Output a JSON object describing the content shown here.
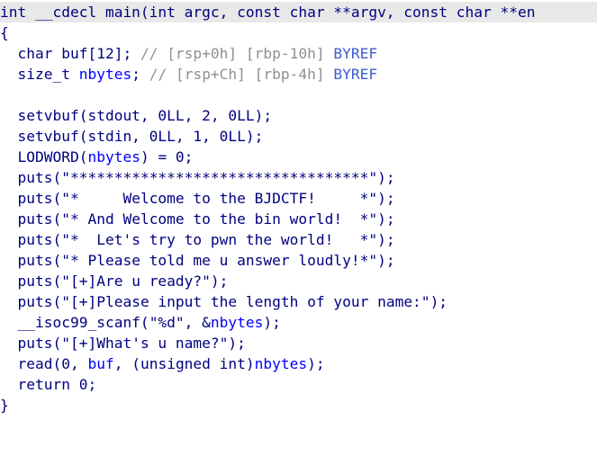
{
  "lines": [
    "int __cdecl main(int argc, const char **argv, const char **en",
    "{",
    "  char buf[12]; // [rsp+0h] [rbp-10h] BYREF",
    "  size_t nbytes; // [rsp+Ch] [rbp-4h] BYREF",
    "",
    "  setvbuf(stdout, 0LL, 2, 0LL);",
    "  setvbuf(stdin, 0LL, 1, 0LL);",
    "  LODWORD(nbytes) = 0;",
    "  puts(\"**********************************\");",
    "  puts(\"*     Welcome to the BJDCTF!     *\");",
    "  puts(\"* And Welcome to the bin world!  *\");",
    "  puts(\"*  Let's try to pwn the world!   *\");",
    "  puts(\"* Please told me u answer loudly!*\");",
    "  puts(\"[+]Are u ready?\");",
    "  puts(\"[+]Please input the length of your name:\");",
    "  __isoc99_scanf(\"%d\", &nbytes);",
    "  puts(\"[+]What's u name?\");",
    "  read(0, buf, (unsigned int)nbytes);",
    "  return 0;",
    "}"
  ],
  "colors": {
    "code": "#000080",
    "comment": "#8f8f8f",
    "variable": "#0000ff",
    "current_line_bg": "#e8e8e8"
  }
}
